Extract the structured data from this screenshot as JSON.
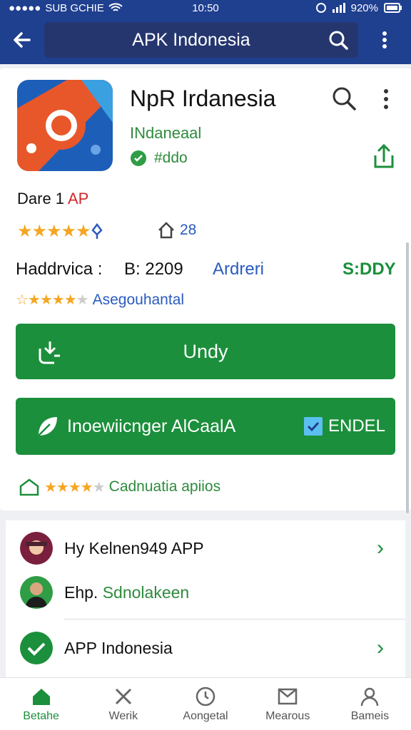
{
  "status_bar": {
    "carrier": "SUB GCHIE",
    "time": "10:50",
    "battery": "920%"
  },
  "app_bar": {
    "title": "APK Indonesia"
  },
  "app": {
    "name": "NpR Irdanesia",
    "developer": "INdaneaal",
    "verified_label": "#ddo",
    "date_label": "Dare 1",
    "date_tag": "AP",
    "download_count": "28",
    "rating_stars": 5,
    "meta": {
      "left": "Haddrvica :",
      "version": "B: 2209",
      "platform": "Ardreri",
      "status": "S:DDY"
    },
    "rating2_stars": 4,
    "rating2_label": "Asegouhantal",
    "rating3_stars": 4,
    "rating3_label": "Cadnuatia apiios"
  },
  "buttons": {
    "primary_label": "Undy",
    "secondary_label": "Inoewiicnger AlCaalA",
    "secondary_tail": "ENDEL"
  },
  "list": [
    {
      "text": "Hy Kelnen949 APP",
      "highlight": ""
    },
    {
      "text": "Ehp.",
      "highlight": "Sdnolakeen"
    },
    {
      "text": "APP Indonesia",
      "highlight": ""
    }
  ],
  "tabs": [
    {
      "label": "Betahe",
      "icon": "home-icon",
      "active": true
    },
    {
      "label": "Werik",
      "icon": "tools-icon",
      "active": false
    },
    {
      "label": "Aongetal",
      "icon": "clock-icon",
      "active": false
    },
    {
      "label": "Mearous",
      "icon": "inbox-icon",
      "active": false
    },
    {
      "label": "Bameis",
      "icon": "user-icon",
      "active": false
    }
  ],
  "colors": {
    "brand": "#1f3f8f",
    "accent": "#1b8f3b",
    "star": "#f5a623",
    "link": "#2a5bbf",
    "tag": "#d0282b"
  }
}
